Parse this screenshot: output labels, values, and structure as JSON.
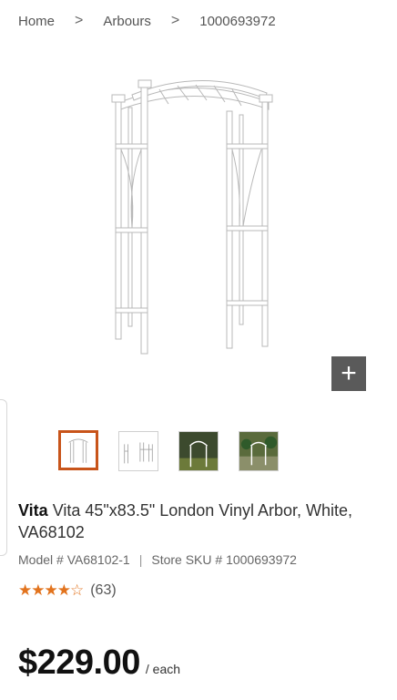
{
  "breadcrumb": {
    "home": "Home",
    "category": "Arbours",
    "sku": "1000693972",
    "separator": ">"
  },
  "gallery": {
    "zoom_label": "+",
    "thumbnails": [
      "Arbour front view",
      "Arbour dimensions diagram",
      "Arbour in garden",
      "Arbour with plants"
    ],
    "selected_index": 0
  },
  "product": {
    "brand": "Vita",
    "name": "Vita 45\"x83.5\" London Vinyl Arbor, White, VA68102",
    "model": "Model # VA68102-1",
    "store_sku": "Store SKU # 1000693972",
    "meta_separator": "|",
    "rating_stars": "★★★★",
    "rating_half": "★",
    "rating_empty": "☆",
    "rating_value": 4.5,
    "review_count": "(63)",
    "price": "$229.00",
    "price_unit": "/ each"
  },
  "colors": {
    "accent": "#e2731d",
    "selected_border": "#c8541a",
    "zoom_bg": "#5a5a5a"
  }
}
